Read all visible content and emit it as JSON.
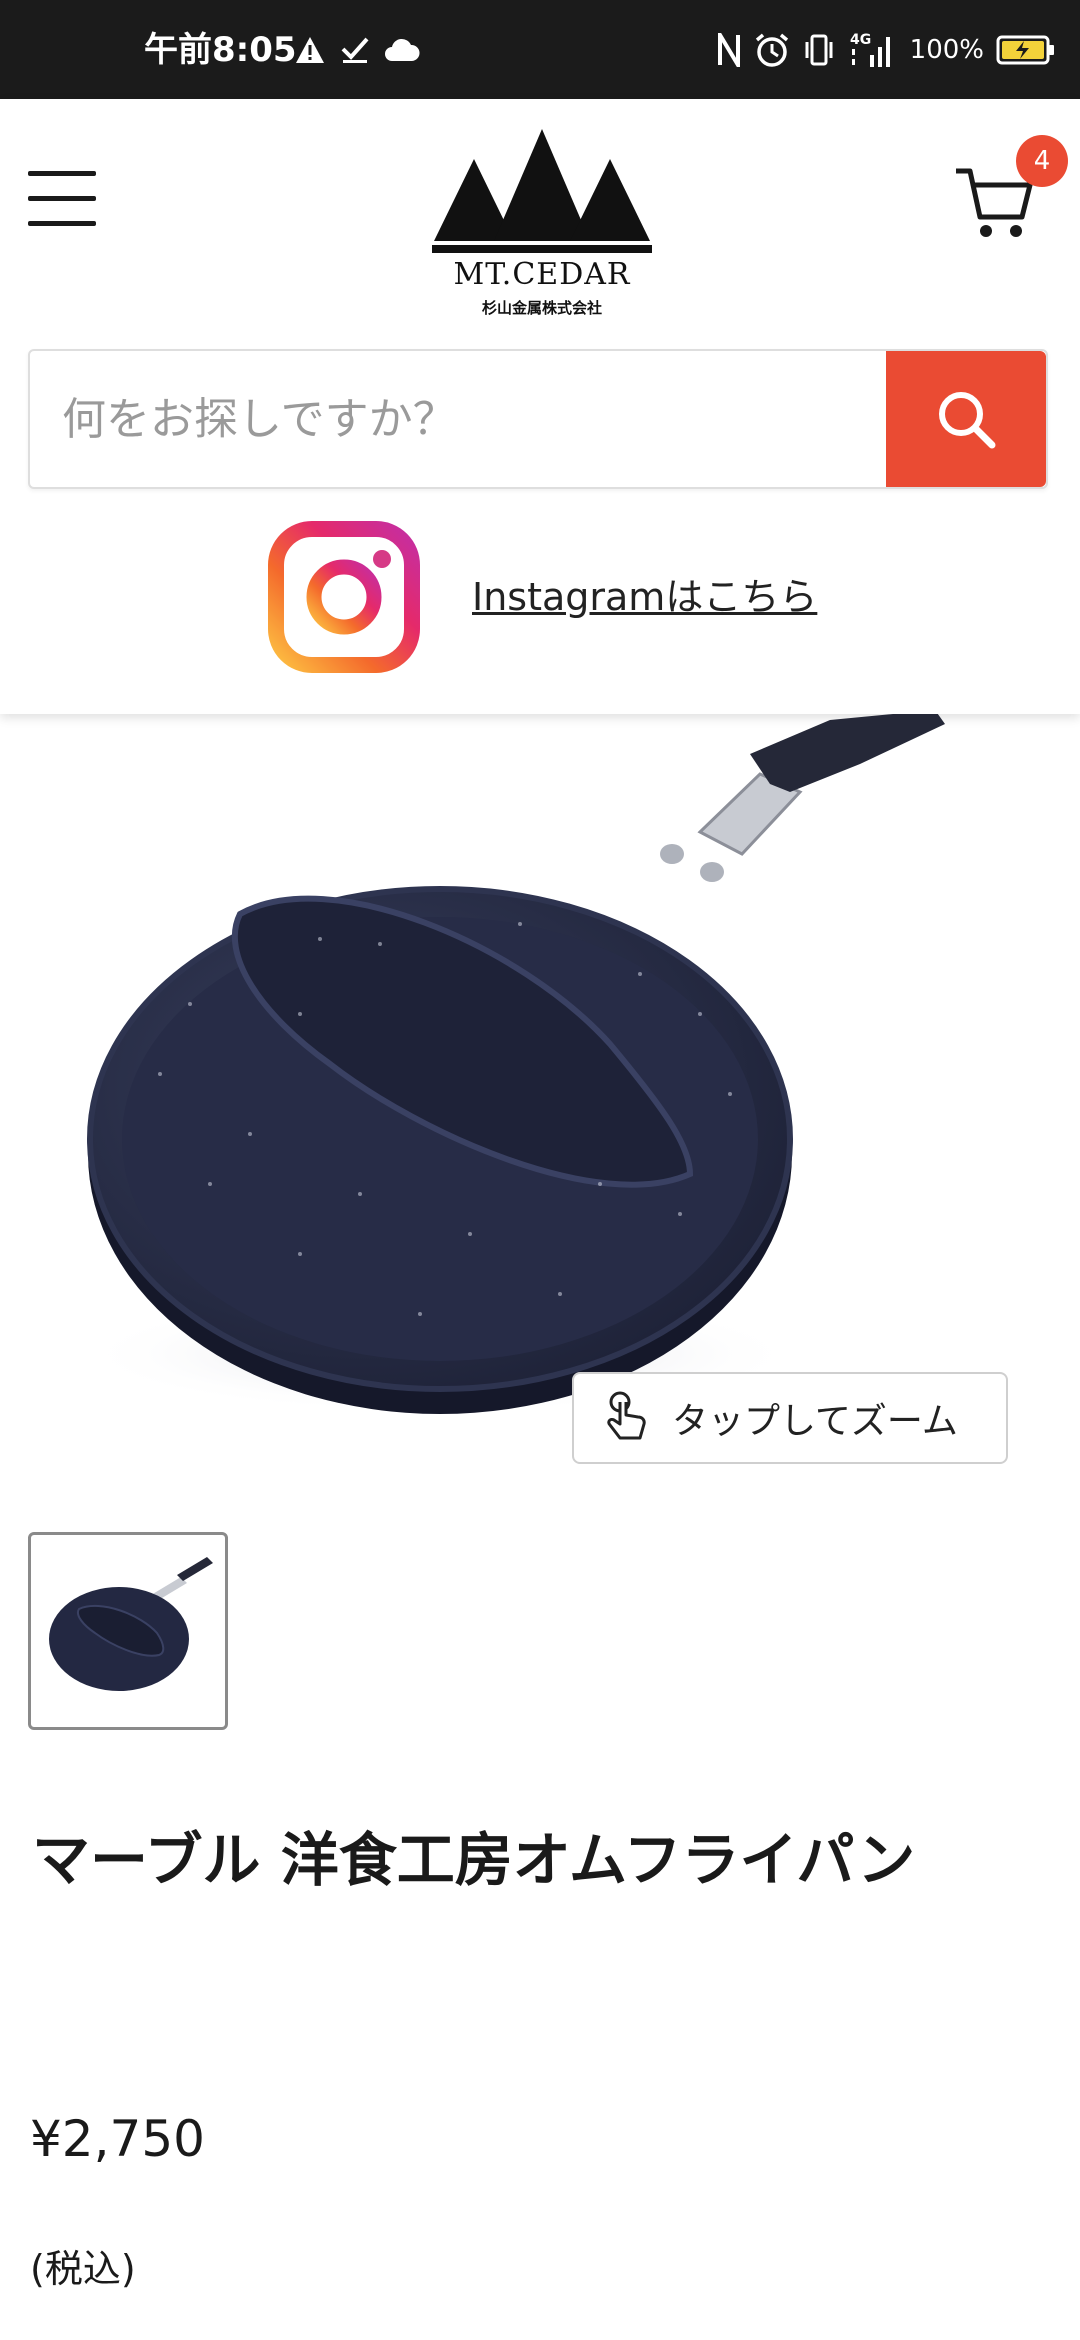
{
  "status_bar": {
    "time": "午前8:05",
    "network": "4G",
    "battery": "100%",
    "icons": [
      "warning-icon",
      "check-icon",
      "cloud-icon",
      "nfc-icon",
      "alarm-icon",
      "vibrate-icon",
      "signal-icon",
      "battery-icon"
    ]
  },
  "header": {
    "logo_name": "MT.CEDAR",
    "logo_sub": "杉山金属株式会社",
    "cart_count": "4",
    "search_placeholder": "何をお探しですか？",
    "instagram_link": "Instagramはこちら"
  },
  "product": {
    "zoom_label": "タップしてズーム",
    "title": "マーブル 洋食工房オムフライパン",
    "price": "¥2,750",
    "tax_note": "(税込)"
  },
  "colors": {
    "accent": "#ea4b33",
    "status_bar": "#1b1b1b",
    "pan": "#2a2f4a"
  }
}
